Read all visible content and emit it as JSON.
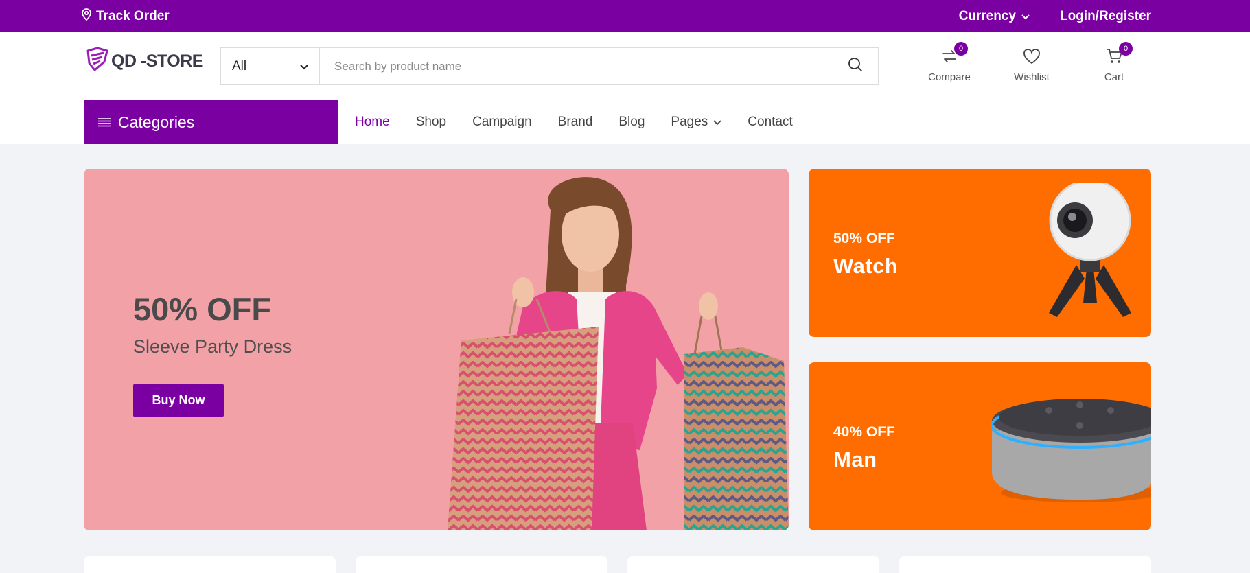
{
  "topbar": {
    "track_order": "Track Order",
    "currency": "Currency",
    "login": "Login/Register",
    "icons": {
      "location": "location-pin-icon",
      "chevron": "chevron-down-icon"
    }
  },
  "header": {
    "logo_text": "QD -STORE",
    "search": {
      "category_value": "All",
      "placeholder": "Search by product name",
      "value": ""
    },
    "actions": [
      {
        "label": "Compare",
        "icon": "compare-icon",
        "count": "0"
      },
      {
        "label": "Wishlist",
        "icon": "heart-icon"
      },
      {
        "label": "Cart",
        "icon": "cart-icon",
        "count": "0"
      }
    ]
  },
  "nav": {
    "categories_label": "Categories",
    "links": [
      {
        "label": "Home",
        "active": true
      },
      {
        "label": "Shop"
      },
      {
        "label": "Campaign"
      },
      {
        "label": "Brand"
      },
      {
        "label": "Blog"
      },
      {
        "label": "Pages",
        "has_dropdown": true
      },
      {
        "label": "Contact"
      }
    ]
  },
  "hero": {
    "discount": "50% OFF",
    "subtitle": "Sleeve Party Dress",
    "button": "Buy Now",
    "background": "#f2a1a6"
  },
  "promos": [
    {
      "discount": "50% OFF",
      "title": "Watch",
      "image": "360-camera-image"
    },
    {
      "discount": "40% OFF",
      "title": "Man",
      "image": "smart-speaker-image"
    }
  ],
  "colors": {
    "brand": "#7b00a2",
    "promo": "#ff6d00",
    "page_bg": "#f2f3f6"
  }
}
